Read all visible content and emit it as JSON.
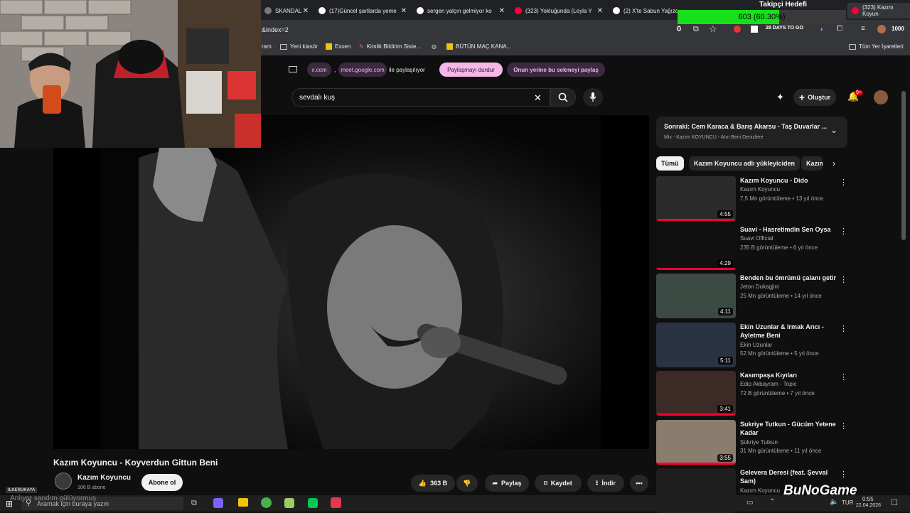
{
  "tabs": [
    {
      "label": "SKANDAL"
    },
    {
      "label": "(17)Güncel şartlarda yeme"
    },
    {
      "label": "sergen yalçın gelmiyor ko"
    },
    {
      "label": "(323) Yokluğunda (Leyla Y"
    },
    {
      "label": "(2) X'te Sabun Yağızo"
    },
    {
      "label": "(323) Kazım Koyun"
    }
  ],
  "goal": {
    "title": "Takipçi Hedefi",
    "value": "603 (60.30%)",
    "fraction": 0.603
  },
  "urlbar": {
    "url": "&index=2",
    "count": "0",
    "extension_text": "28 DAYS TO GO",
    "counter_right": "1000"
  },
  "bookmarks": [
    {
      "label": "ram"
    },
    {
      "label": "Yeni klasör"
    },
    {
      "label": "Exxen"
    },
    {
      "label": "Kimlik Bildirim Siste..."
    },
    {
      "label": "BÜTÜN MAÇ KANA..."
    },
    {
      "label": "Tüm Yer İşaretleri"
    }
  ],
  "share_bar": {
    "site1": "x.com",
    "separator": ",",
    "site2": "meet.google.com",
    "suffix": "ile paylaşılıyor",
    "stop_button": "Paylaşmayı durdur",
    "share_this_button": "Onun yerine bu sekmeyi paylaş"
  },
  "search": {
    "value": "sevdalı kuş"
  },
  "header": {
    "create_label": "Oluştur",
    "notif_count": "9+"
  },
  "video": {
    "title": "Kazım Koyuncu - Koyverdun Gittun Beni",
    "channel": "Kazım Koyuncu",
    "subscribers": "106 B abone",
    "subscribe_label": "Abone ol",
    "likes": "363 B",
    "share_label": "Paylaş",
    "save_label": "Kaydet",
    "download_label": "İndir"
  },
  "mix": {
    "next": "Sonraki: Cem Karaca & Barış Akarsu - Taş Duvarlar ...",
    "subtitle": "Mix - Kazım KOYUNCU - Atın Beni Denizlere"
  },
  "chips": [
    {
      "label": "Tümü"
    },
    {
      "label": "Kazım Koyuncu adlı yükleyiciden"
    },
    {
      "label": "Kazım"
    }
  ],
  "recommendations": [
    {
      "title": "Kazım Koyuncu - Dido",
      "channel": "Kazım Koyuncu",
      "meta": "7,5 Mn görüntüleme • 13 yıl önce",
      "duration": "4:55",
      "thumb_color": "#2b2b2b",
      "watched": 1.0
    },
    {
      "title": "Suavi - Hasretimdin Sen Oysa",
      "channel": "Suavi Official",
      "meta": "235 B görüntüleme • 6 yıl önce",
      "duration": "4:29",
      "thumb_color": "#111111",
      "watched": 1.0
    },
    {
      "title": "Benden bu ömrümü çalanı getir",
      "channel": "Jeton Dukagjini",
      "meta": "25 Mn görüntüleme • 14 yıl önce",
      "duration": "4:11",
      "thumb_color": "#3c4a44",
      "watched": 0.0
    },
    {
      "title": "Ekin Uzunlar & Irmak Arıcı - Ayletme Beni",
      "channel": "Ekin Uzunlar",
      "meta": "52 Mn görüntüleme • 5 yıl önce",
      "duration": "5:11",
      "thumb_color": "#2a3342",
      "watched": 0.0
    },
    {
      "title": "Kasımpaşa Kıyıları",
      "channel": "Edip Akbayram - Topic",
      "meta": "72 B görüntüleme • 7 yıl önce",
      "duration": "3:41",
      "thumb_color": "#3b2a26",
      "watched": 1.0
    },
    {
      "title": "Sukriye Tutkun - Gücüm Yetene Kadar",
      "channel": "Şükriye Tutkun",
      "meta": "31 Mn görüntüleme • 11 yıl önce",
      "duration": "3:55",
      "thumb_color": "#8a7d6d",
      "watched": 1.0
    },
    {
      "title": "Gelevera Deresi (feat. Şevval Sam)",
      "channel": "Kazım Koyuncu",
      "meta": "",
      "duration": "",
      "thumb_color": "#1e1e1e",
      "watched": 0.0
    }
  ],
  "taskbar": {
    "search_placeholder": "Aramak için buraya yazın",
    "lang": "TUR",
    "time": "0:55",
    "date": "22.04.2026"
  },
  "overlay": {
    "caption": "Anlıyor sandım gülüyormuş",
    "logo": "BuNoGame",
    "small_tag": "ILKERUKAYA"
  },
  "colors": {
    "accent": "#ff0033",
    "share_pill": "#f6b7e8",
    "goal_green": "#18e01a"
  }
}
